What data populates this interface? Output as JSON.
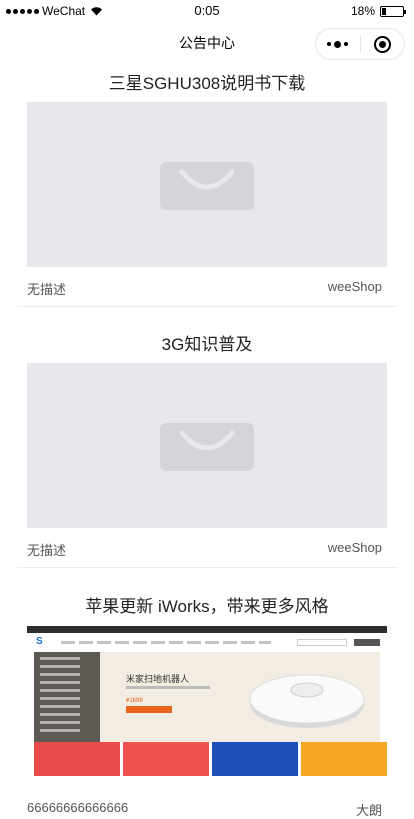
{
  "status_bar": {
    "carrier": "WeChat",
    "time": "0:05",
    "battery_percent": "18%",
    "battery_level": 0.18
  },
  "nav": {
    "title": "公告中心"
  },
  "articles": [
    {
      "title": "三星SGHU308说明书下载",
      "description": "无描述",
      "source": "weeShop"
    },
    {
      "title": "3G知识普及",
      "description": "无描述",
      "source": "weeShop"
    },
    {
      "title": "苹果更新 iWorks，带来更多风格",
      "description": "66666666666666",
      "source": "大朗"
    }
  ],
  "mini_site": {
    "logo": "S",
    "banner_title": "米家扫地机器人",
    "banner_price": "¥1699"
  },
  "colors": {
    "placeholder_bg": "#e7e8eb",
    "placeholder_icon": "#d4d5d9",
    "promo_colors": [
      "#e94b4b",
      "#ef5350",
      "#1f4fb8",
      "#f5a623"
    ]
  }
}
